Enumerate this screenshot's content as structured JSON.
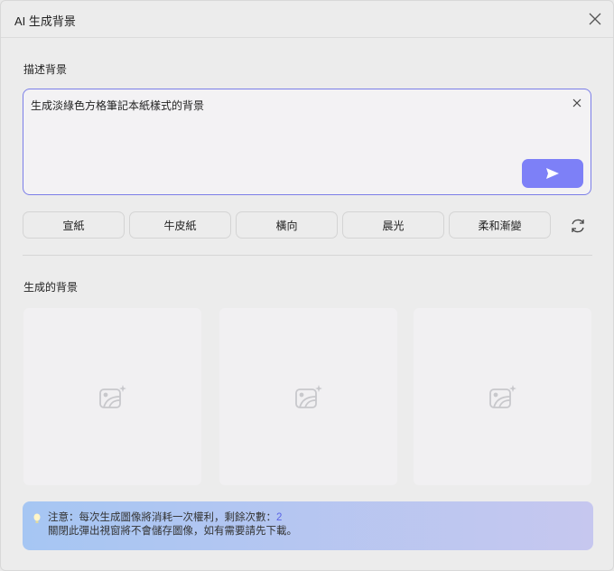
{
  "header": {
    "title": "AI 生成背景"
  },
  "describe": {
    "label": "描述背景",
    "value": "生成淡綠色方格筆記本紙樣式的背景"
  },
  "presets": [
    "宣紙",
    "牛皮紙",
    "橫向",
    "晨光",
    "柔和漸變"
  ],
  "generated": {
    "label": "生成的背景",
    "slots": 3
  },
  "notice": {
    "line1": "注意：每次生成圖像將消耗一次權利，剩餘次數：",
    "remaining": "2",
    "line2": "關閉此彈出視窗將不會儲存圖像，如有需要請先下載。"
  },
  "colors": {
    "accent": "#7d80f7",
    "border_focus": "#7b7ee8"
  }
}
